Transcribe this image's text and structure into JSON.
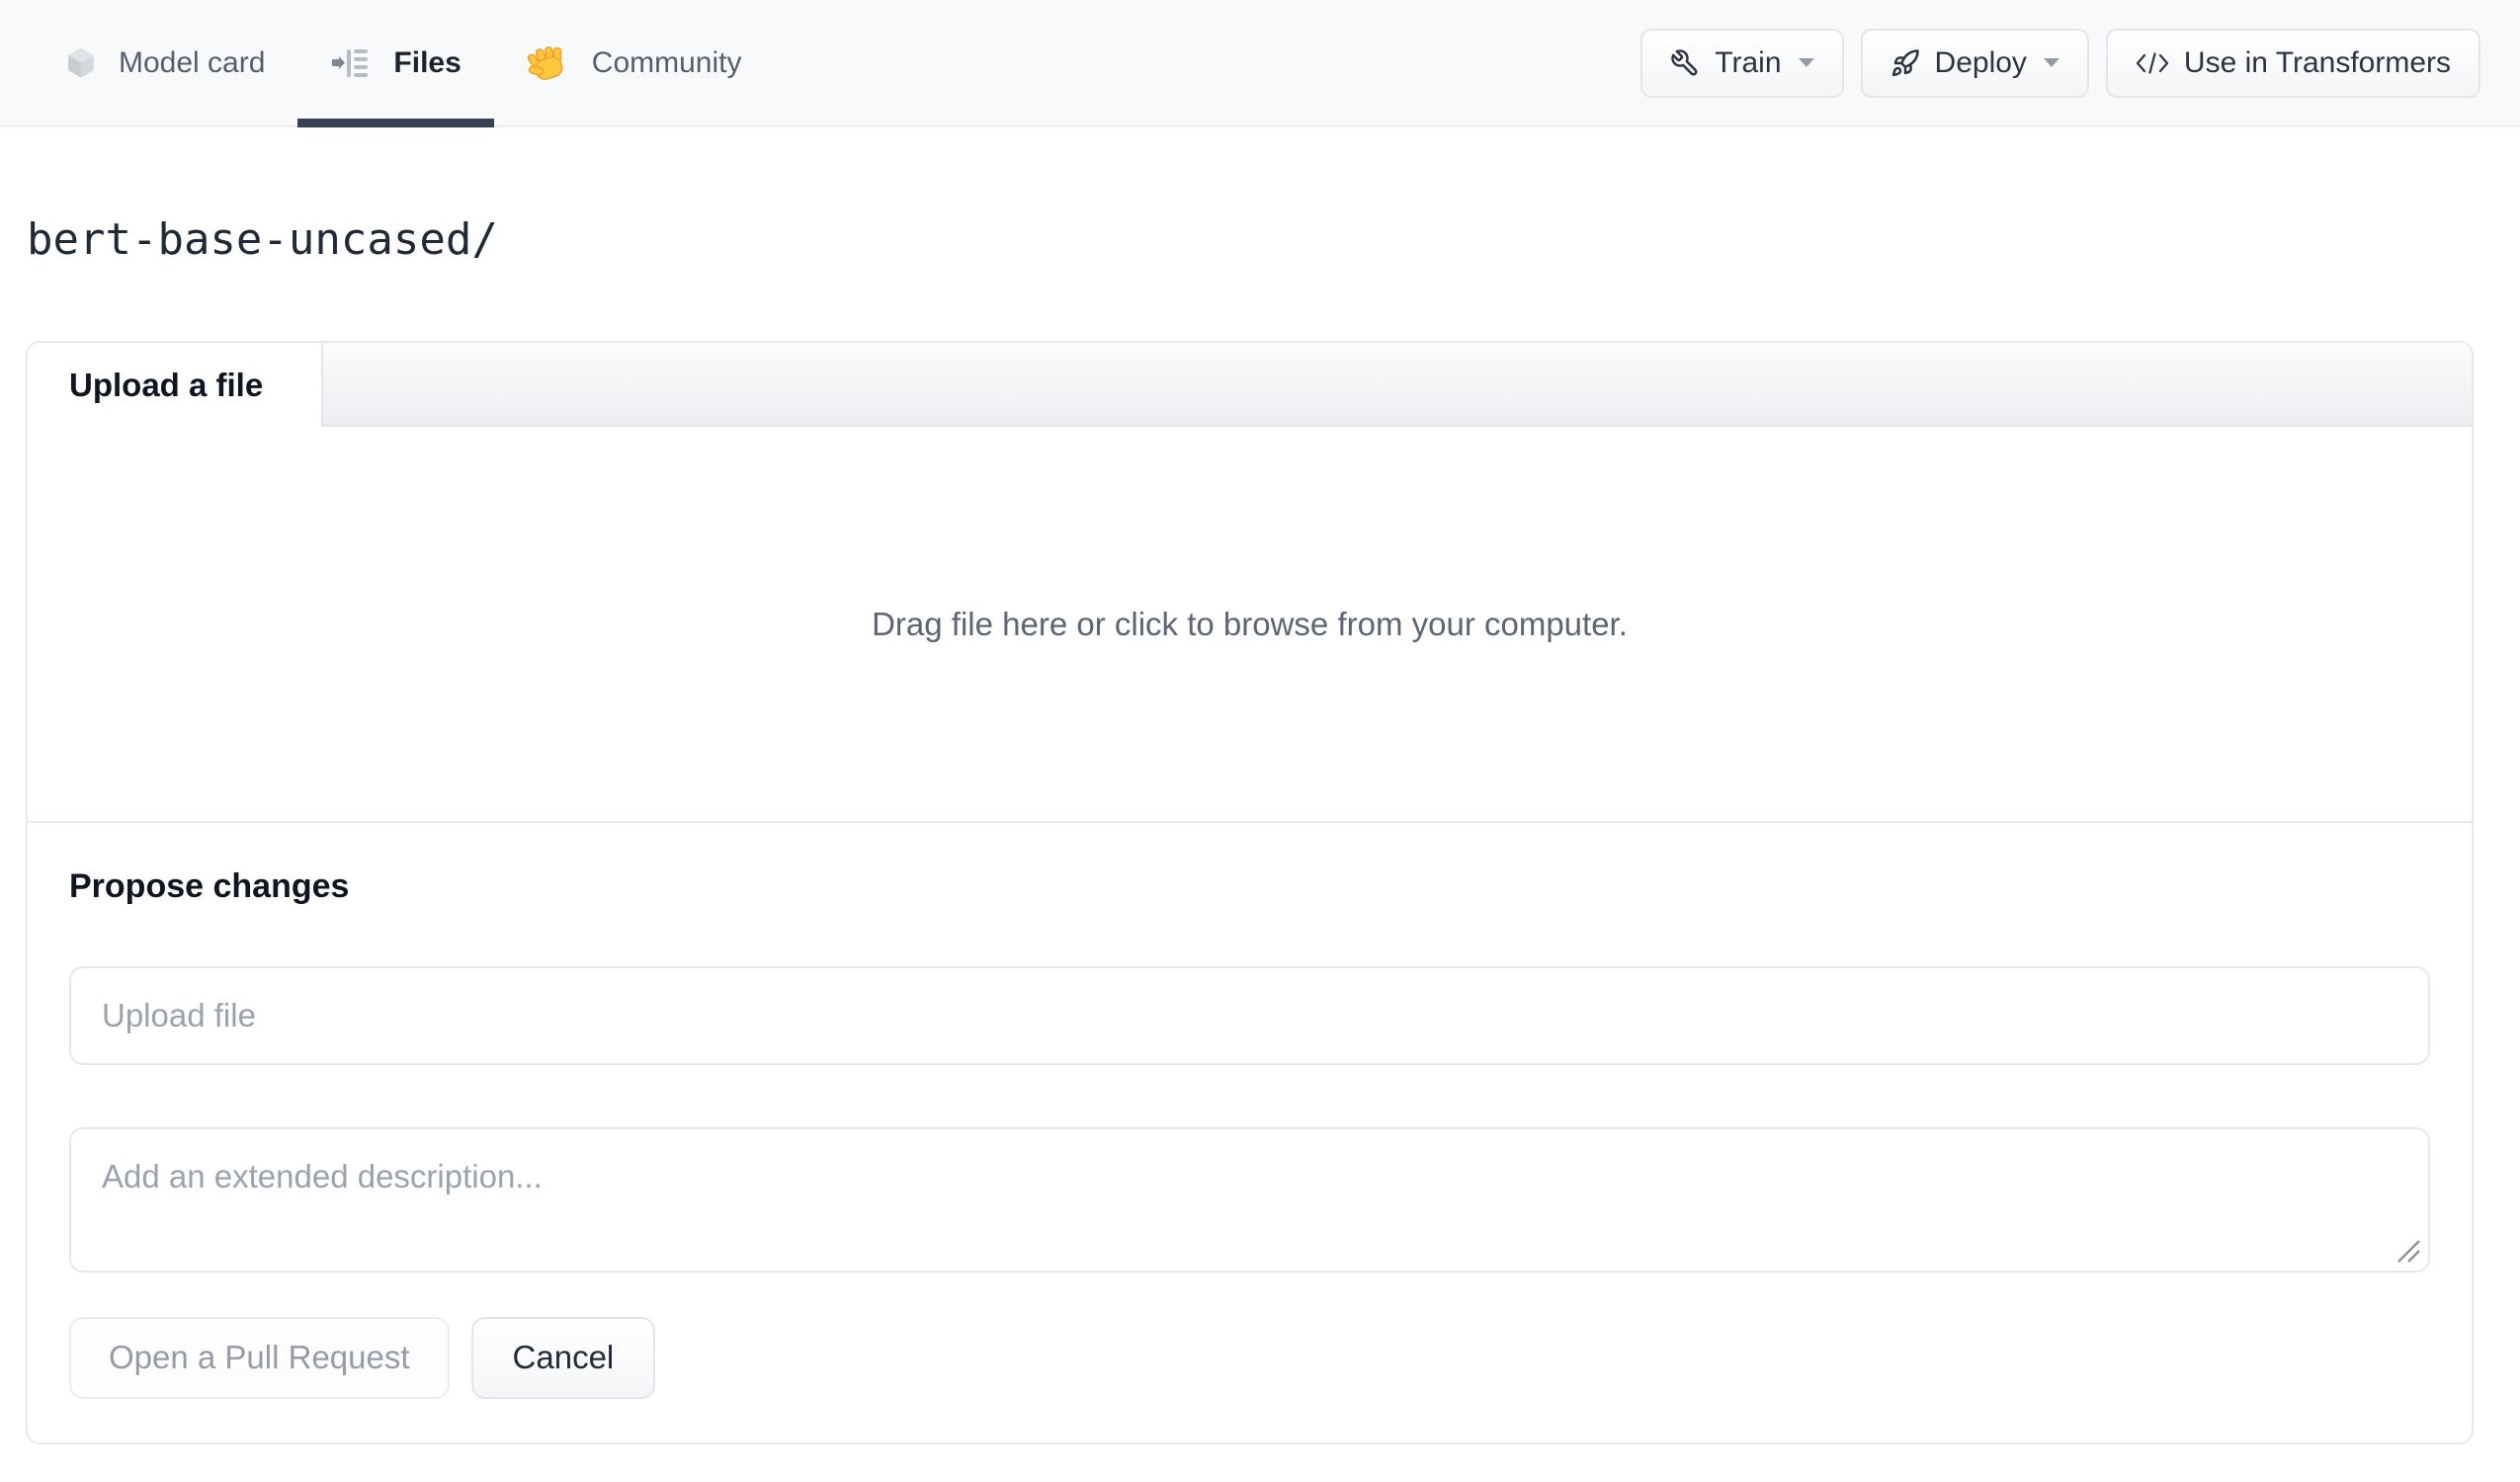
{
  "nav": {
    "tabs": [
      {
        "label": "Model card",
        "icon": "cube-icon",
        "active": false
      },
      {
        "label": "Files",
        "icon": "files-list-icon",
        "active": true
      },
      {
        "label": "Community",
        "icon": "waving-hand-icon",
        "active": false
      }
    ],
    "actions": [
      {
        "label": "Train",
        "icon": "wrench-icon",
        "has_caret": true
      },
      {
        "label": "Deploy",
        "icon": "rocket-icon",
        "has_caret": true
      },
      {
        "label": "Use in Transformers",
        "icon": "code-icon",
        "has_caret": false
      }
    ]
  },
  "breadcrumb": {
    "path": "bert-base-uncased/"
  },
  "upload_card": {
    "tab_label": "Upload a file",
    "dropzone_text": "Drag file here or click to browse from your computer.",
    "propose_heading": "Propose changes",
    "filename_placeholder": "Upload file",
    "description_placeholder": "Add an extended description...",
    "buttons": {
      "submit": "Open a Pull Request",
      "cancel": "Cancel"
    }
  },
  "colors": {
    "navbar_bg": "#f8f9fb",
    "active_tab_underline": "#364153",
    "nav_text": "#545e70",
    "nav_text_active": "#1a2332",
    "card_border": "#e7e9ed",
    "tab_filler_gradient_bottom": "#eceef1",
    "dropzone_text": "#5c6575",
    "placeholder": "#9aa2b0",
    "disabled_button_text": "#959ca8",
    "hand_emoji_yellow": "#ffc83d",
    "hand_emoji_orange": "#f1a42b"
  }
}
